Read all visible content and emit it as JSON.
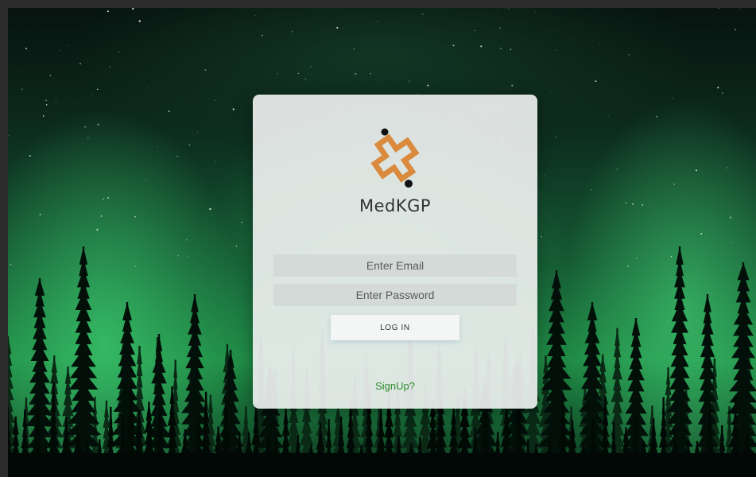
{
  "brand": {
    "logo_icon": "medkgp-cross-logo-icon",
    "name": "MedKGP",
    "logo_color": "#d98a3c"
  },
  "login_form": {
    "email_placeholder": "Enter Email",
    "password_placeholder": "Enter Password",
    "login_label": "LOG IN",
    "signup_label": "SignUp?",
    "signup_color": "#2e8b2e"
  },
  "background": {
    "scene": "aurora-forest-night",
    "accent": "#1f8a45"
  }
}
